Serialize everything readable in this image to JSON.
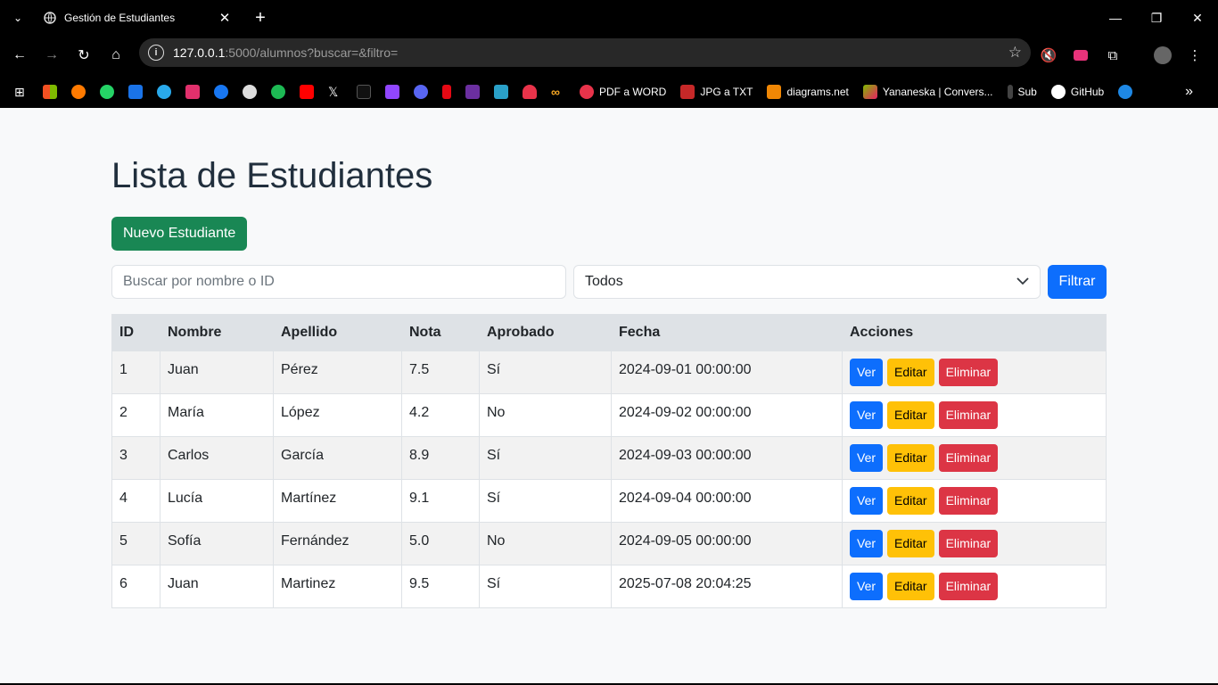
{
  "browser": {
    "tab_title": "Gestión de Estudiantes",
    "url_host": "127.0.0.1",
    "url_rest": ":5000/alumnos?buscar=&filtro=",
    "bookmarks": [
      "PDF a WORD",
      "JPG a TXT",
      "diagrams.net",
      "Yananeska | Convers...",
      "Sub",
      "GitHub"
    ]
  },
  "page": {
    "title": "Lista de Estudiantes",
    "new_button": "Nuevo Estudiante",
    "search_placeholder": "Buscar por nombre o ID",
    "filter_selected": "Todos",
    "filter_button": "Filtrar"
  },
  "table": {
    "headers": [
      "ID",
      "Nombre",
      "Apellido",
      "Nota",
      "Aprobado",
      "Fecha",
      "Acciones"
    ],
    "rows": [
      [
        "1",
        "Juan",
        "Pérez",
        "7.5",
        "Sí",
        "2024-09-01 00:00:00"
      ],
      [
        "2",
        "María",
        "López",
        "4.2",
        "No",
        "2024-09-02 00:00:00"
      ],
      [
        "3",
        "Carlos",
        "García",
        "8.9",
        "Sí",
        "2024-09-03 00:00:00"
      ],
      [
        "4",
        "Lucía",
        "Martínez",
        "9.1",
        "Sí",
        "2024-09-04 00:00:00"
      ],
      [
        "5",
        "Sofía",
        "Fernández",
        "5.0",
        "No",
        "2024-09-05 00:00:00"
      ],
      [
        "6",
        "Juan",
        "Martinez",
        "9.5",
        "Sí",
        "2025-07-08 20:04:25"
      ]
    ],
    "actions": {
      "view": "Ver",
      "edit": "Editar",
      "delete": "Eliminar"
    }
  }
}
